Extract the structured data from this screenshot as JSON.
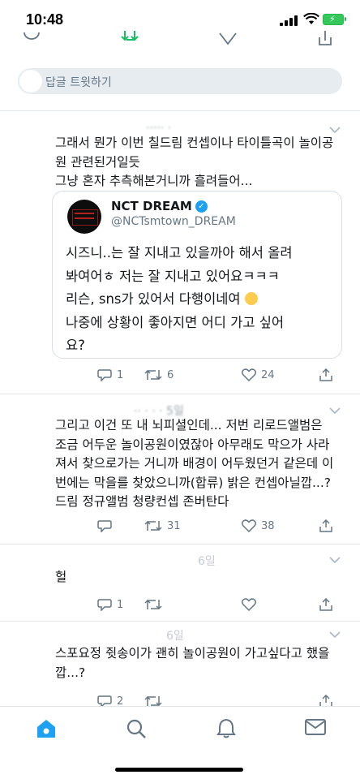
{
  "status_bar": {
    "time": "10:48"
  },
  "reply_bar": {
    "placeholder": "답글 트윗하기"
  },
  "faint_headers": [
    "6일",
    "6일"
  ],
  "tweets": [
    {
      "lines": [
        "그래서 뭔가 이번 칠드림 컨셉이나 타이틀곡이 놀이공",
        "원 관련된거일듯",
        "그냥 혼자 추측해본거니까 흘려들어..."
      ],
      "quote": {
        "name": "NCT DREAM",
        "handle": "@NCTsmtown_DREAM",
        "lines": [
          "시즈니..는 잘 지내고 있을까아 해서 올려",
          "봐여어ㅎ 저는 잘 지내고 있어요ㅋㅋㅋ",
          "리슨, sns가 있어서 다행이네여",
          "나중에 상황이 좋아지면 어디 가고 싶어",
          "요?"
        ]
      },
      "stats": {
        "replies": "1",
        "retweets": "6",
        "likes": "24"
      }
    },
    {
      "lines": [
        "그리고 이건 또 내 뇌피셜인데... 저번 리로드앨범은",
        "조금 어두운 놀이공원이였잖아 아무래도 막으가 사라",
        "져서 찾으로가는 거니까 배경이 어두웠던거 같은데 이",
        "번에는 막을를 찾았으니까(합류) 밝은 컨셉아닐깝...?",
        "드림 정규앨범 청량컨셉 존버탄다"
      ],
      "stats": {
        "replies": "",
        "retweets": "31",
        "likes": "38"
      }
    },
    {
      "lines": [
        "헐"
      ],
      "stats": {
        "replies": "1",
        "retweets": "",
        "likes": ""
      }
    },
    {
      "lines": [
        "스포요정 쥣송이가 괜히 놀이공원이 가고싶다고 했을",
        "깝...?"
      ],
      "stats": {
        "replies": "2",
        "retweets": "",
        "likes": ""
      }
    }
  ],
  "tab_bar": {
    "tabs": [
      "home-icon",
      "search-icon",
      "notifications-icon",
      "messages-icon"
    ],
    "active_color": "#1da1f2",
    "inactive_color": "#657786"
  },
  "colors": {
    "accent": "#1da1f2",
    "secondary_text": "#657786",
    "divider": "#e1e8ed"
  }
}
